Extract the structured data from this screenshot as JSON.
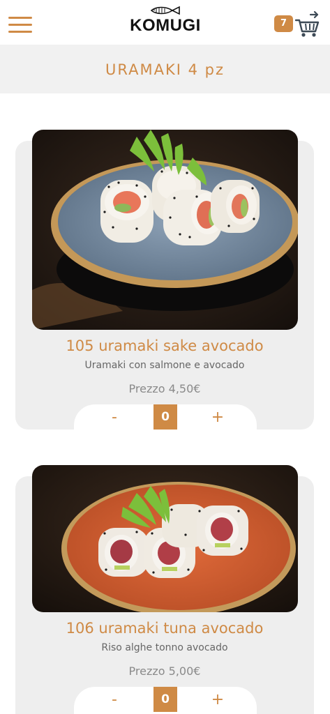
{
  "header": {
    "brand": "KOMUGI",
    "cart_count": "7",
    "accent": "#cf8a45",
    "menu_icon": "hamburger-menu-icon",
    "cart_icon": "shopping-cart-icon"
  },
  "section": {
    "title": "URAMAKI 4 pz"
  },
  "products": [
    {
      "title": "105 uramaki sake avocado",
      "description": "Uramaki con salmone e avocado",
      "price": "Prezzo 4,50€",
      "qty": "0",
      "minus": "-",
      "plus": "+",
      "image": "photo of salmon avocado uramaki on blue plate"
    },
    {
      "title": "106 uramaki tuna avocado",
      "description": "Riso alghe tonno avocado",
      "price": "Prezzo 5,00€",
      "qty": "0",
      "minus": "-",
      "plus": "+",
      "image": "photo of tuna avocado uramaki on orange plate"
    }
  ]
}
